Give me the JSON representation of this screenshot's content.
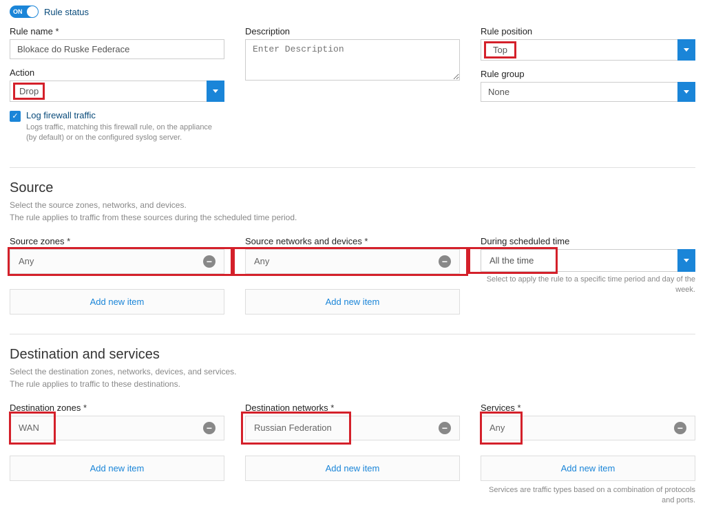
{
  "header": {
    "toggle_state": "ON",
    "rule_status_label": "Rule status"
  },
  "rule_name": {
    "label": "Rule name",
    "value": "Blokace do Ruske Federace"
  },
  "action": {
    "label": "Action",
    "value": "Drop"
  },
  "description": {
    "label": "Description",
    "placeholder": "Enter Description"
  },
  "rule_position": {
    "label": "Rule position",
    "value": "Top"
  },
  "rule_group": {
    "label": "Rule group",
    "value": "None"
  },
  "log_traffic": {
    "label": "Log firewall traffic",
    "help": "Logs traffic, matching this firewall rule, on the appliance (by default) or on the configured syslog server."
  },
  "source": {
    "title": "Source",
    "desc1": "Select the source zones, networks, and devices.",
    "desc2": "The rule applies to traffic from these sources during the scheduled time period.",
    "zones": {
      "label": "Source zones",
      "value": "Any"
    },
    "networks": {
      "label": "Source networks and devices",
      "value": "Any"
    },
    "schedule": {
      "label": "During scheduled time",
      "value": "All the time",
      "help": "Select to apply the rule to a specific time period and day of the week."
    }
  },
  "destination": {
    "title": "Destination and services",
    "desc1": "Select the destination zones, networks, devices, and services.",
    "desc2": "The rule applies to traffic to these destinations.",
    "zones": {
      "label": "Destination zones",
      "value": "WAN"
    },
    "networks": {
      "label": "Destination networks",
      "value": "Russian Federation"
    },
    "services": {
      "label": "Services",
      "value": "Any",
      "help": "Services are traffic types based on a combination of protocols and ports."
    }
  },
  "common": {
    "add_new_item": "Add new item"
  }
}
